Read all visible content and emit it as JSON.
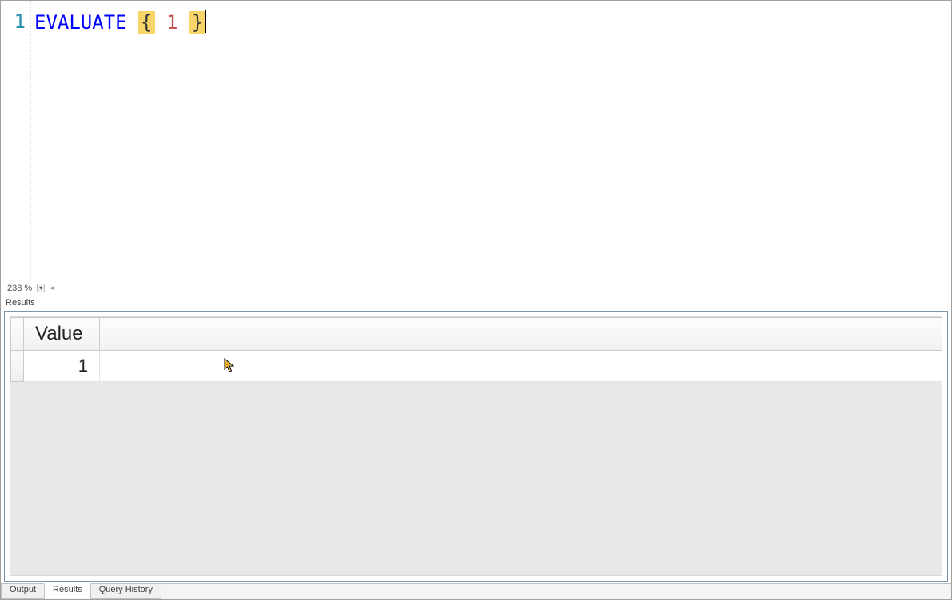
{
  "editor": {
    "line_number": "1",
    "tokens": {
      "keyword": "EVALUATE",
      "brace_open": "{",
      "number": "1",
      "brace_close": "}"
    },
    "zoom_level": "238 %"
  },
  "results": {
    "panel_label": "Results",
    "column_header": "Value",
    "rows": [
      {
        "value": "1"
      }
    ]
  },
  "tabs": {
    "output": "Output",
    "results": "Results",
    "query_history": "Query History"
  }
}
